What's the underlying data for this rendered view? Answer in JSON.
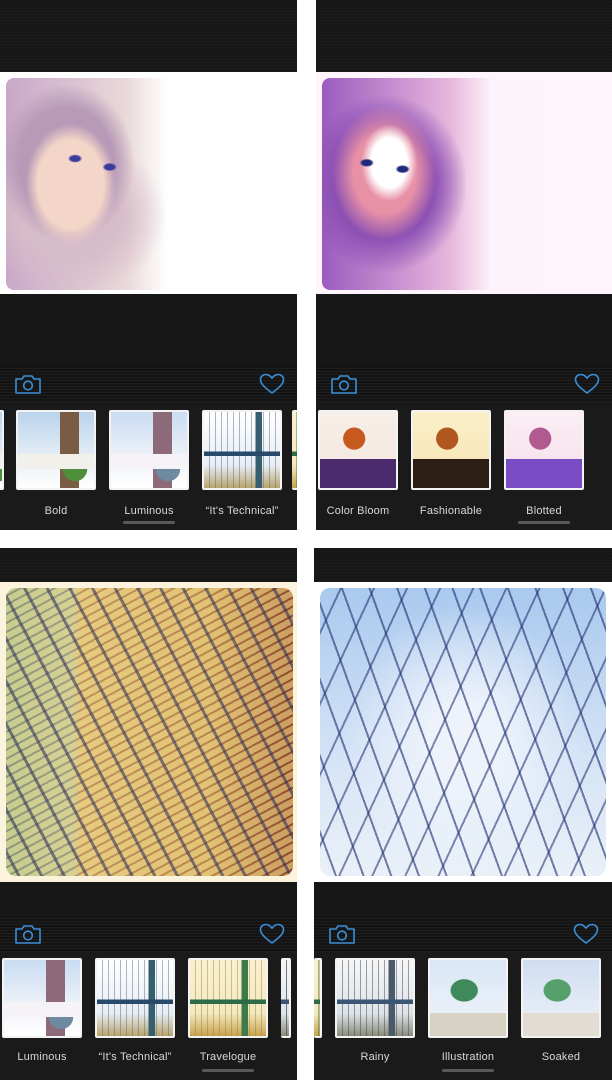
{
  "accent_color": "#3a8fd8",
  "icons": {
    "camera": "camera-icon",
    "favorite": "heart-icon"
  },
  "screens": [
    {
      "name": "screen-1",
      "photo_subject": "girl portrait (soft watercolor)",
      "filters": [
        {
          "label": "",
          "partial": true,
          "art": "t-castle"
        },
        {
          "label": "Bold",
          "art": "t-castle"
        },
        {
          "label": "Luminous",
          "art": "t-castle-lum",
          "selected": true
        },
        {
          "label": "“It's Technical”",
          "art": "t-bridge"
        },
        {
          "label": "",
          "partial": true,
          "art": "t-bridge-warm"
        }
      ]
    },
    {
      "name": "screen-2",
      "photo_subject": "girl portrait (blotted watercolor)",
      "filters": [
        {
          "label": "Color Bloom",
          "art": "t-woman-bloom"
        },
        {
          "label": "Fashionable",
          "art": "t-woman-fash"
        },
        {
          "label": "Blotted",
          "art": "t-woman-blot",
          "selected": true
        }
      ]
    },
    {
      "name": "screen-3",
      "photo_subject": "building looking up (travelogue watercolor)",
      "filters": [
        {
          "label": "Luminous",
          "art": "t-castle-lum"
        },
        {
          "label": "“It's Technical”",
          "art": "t-bridge"
        },
        {
          "label": "Travelogue",
          "art": "t-bridge-warm",
          "selected": true
        },
        {
          "label": "",
          "partial": true,
          "art": "t-bridge-gray"
        }
      ]
    },
    {
      "name": "screen-4",
      "photo_subject": "bare tree branches against sky (illustration watercolor)",
      "filters": [
        {
          "label": "",
          "partial": true,
          "art": "t-bridge-warm"
        },
        {
          "label": "Rainy",
          "art": "t-bridge-gray"
        },
        {
          "label": "Illustration",
          "art": "t-dragon",
          "selected": true
        },
        {
          "label": "Soaked",
          "art": "t-dragon-soak"
        }
      ]
    }
  ]
}
